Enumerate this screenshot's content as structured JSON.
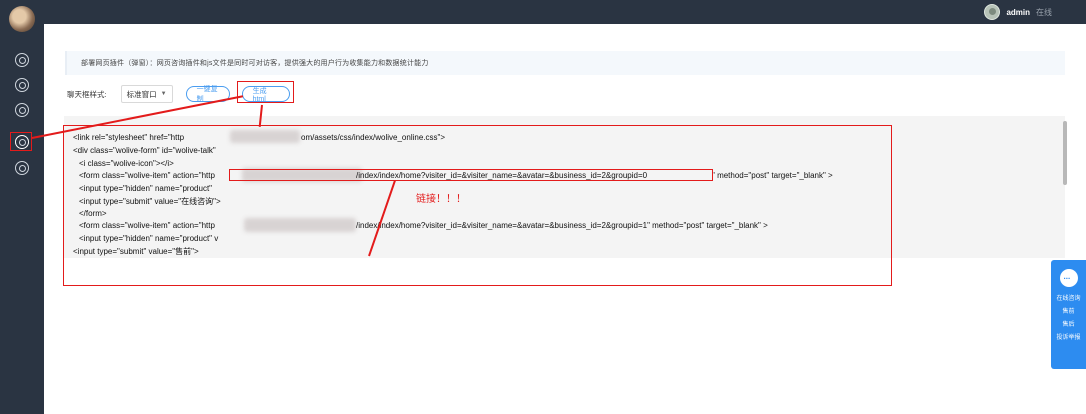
{
  "header": {
    "username": "admin",
    "status": "在线"
  },
  "sidebar": {
    "items": [
      {
        "name": "home-icon"
      },
      {
        "name": "chat-icon"
      },
      {
        "name": "user-icon"
      },
      {
        "name": "settings-icon"
      },
      {
        "name": "history-icon"
      }
    ]
  },
  "notice": "部署网页插件（弹窗）：网页咨询插件和js文件是同时可对访客，提供强大的用户行为收集能力和数据统计能力",
  "toolbar": {
    "style_label": "聊天框样式:",
    "style_value": "标准窗口",
    "copy_button": "一键复制",
    "generate_button": "生成html"
  },
  "code_lines": [
    "<link rel=\"stylesheet\" href=\"http",
    "om/assets/css/index/wolive_online.css\">",
    "<div class=\"wolive-form\" id=\"wolive-talk\"",
    "<i class=\"wolive-icon\"></i>",
    "<form class=\"wolive-item\" action=\"http",
    "/index/index/home?visiter_id=&visiter_name=&avatar=&business_id=2&groupid=0",
    "\" method=\"post\" target=\"_blank\" >",
    "<input type=\"hidden\" name=\"product\"",
    "<input type=\"submit\" value=\"在线咨询\">",
    "</form>",
    "<form class=\"wolive-item\" action=\"http",
    "/index/index/home?visiter_id=&visiter_name=&avatar=&business_id=2&groupid=1\" method=\"post\" target=\"_blank\" >",
    "<input type=\"hidden\" name=\"product\" v",
    "<input type=\"submit\" value=\"售前\">"
  ],
  "annotation_note": "链接！！！",
  "chat_widget": {
    "title": "在线咨询",
    "items": [
      "售前",
      "售后",
      "投诉举报"
    ]
  },
  "colors": {
    "sidebar": "#2a3442",
    "accent": "#2d8cf0",
    "annotation": "#e31b1b"
  }
}
